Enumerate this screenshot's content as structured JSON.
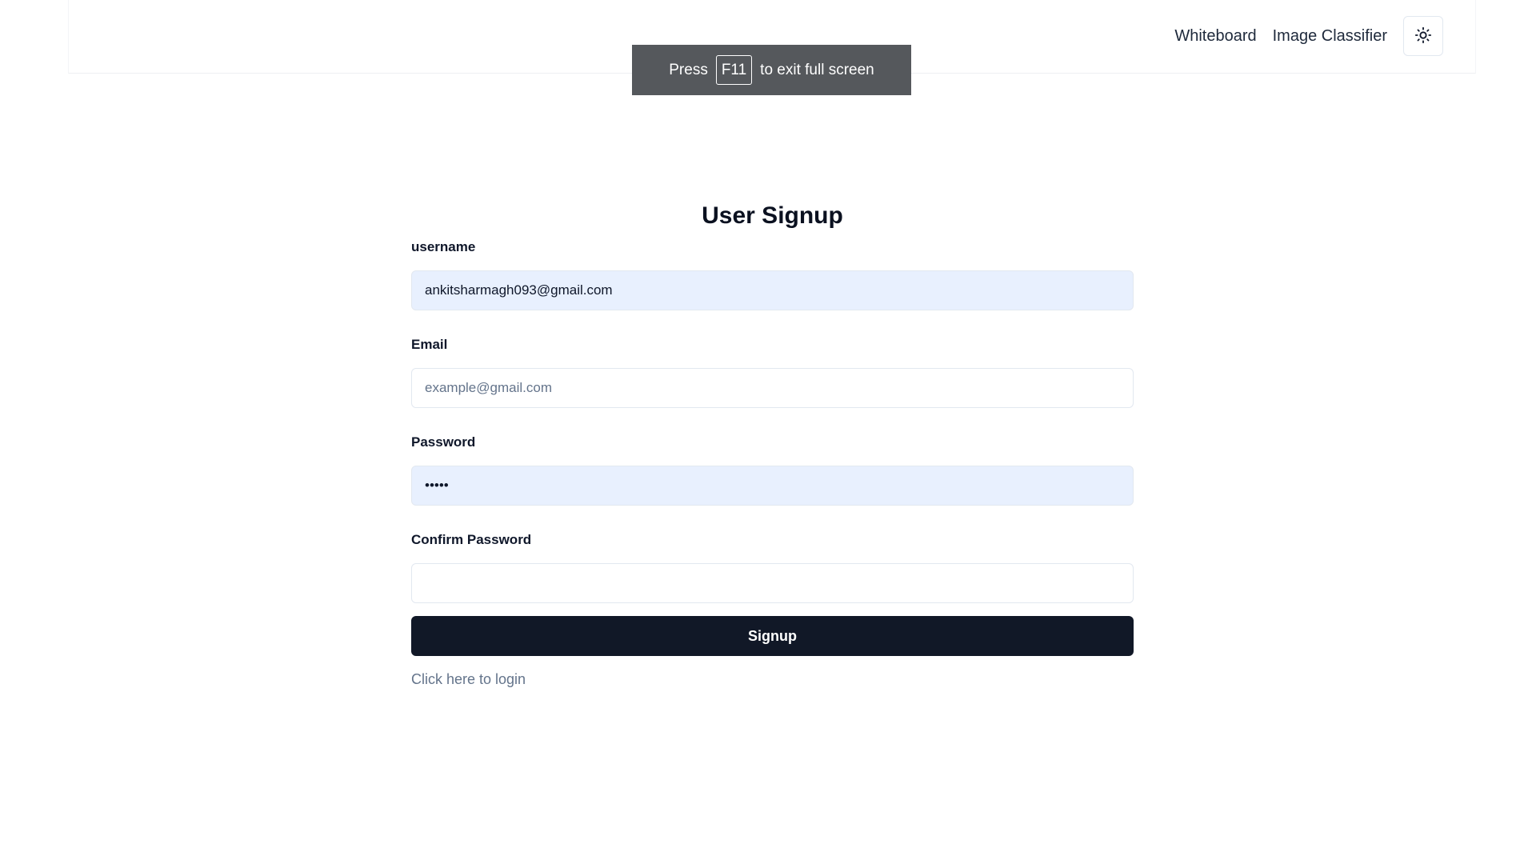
{
  "navbar": {
    "links": [
      "Whiteboard",
      "Image Classifier"
    ],
    "theme_toggle_icon": "sun-icon"
  },
  "toast": {
    "prefix": "Press",
    "key": "F11",
    "suffix": "to exit full screen"
  },
  "form": {
    "title": "User Signup",
    "fields": [
      {
        "label": "username",
        "value": "ankitsharmagh093@gmail.com",
        "placeholder": "",
        "type": "text"
      },
      {
        "label": "Email",
        "value": "",
        "placeholder": "example@gmail.com",
        "type": "email"
      },
      {
        "label": "Password",
        "value": "•••••",
        "placeholder": "",
        "type": "password"
      },
      {
        "label": "Confirm Password",
        "value": "",
        "placeholder": "",
        "type": "password"
      }
    ],
    "submit_label": "Signup",
    "login_link": "Click here to login"
  },
  "colors": {
    "button_bg": "#111827",
    "autofill_bg": "#e8f0fe",
    "toast_bg": "#55585c",
    "link_muted": "#64748b"
  }
}
